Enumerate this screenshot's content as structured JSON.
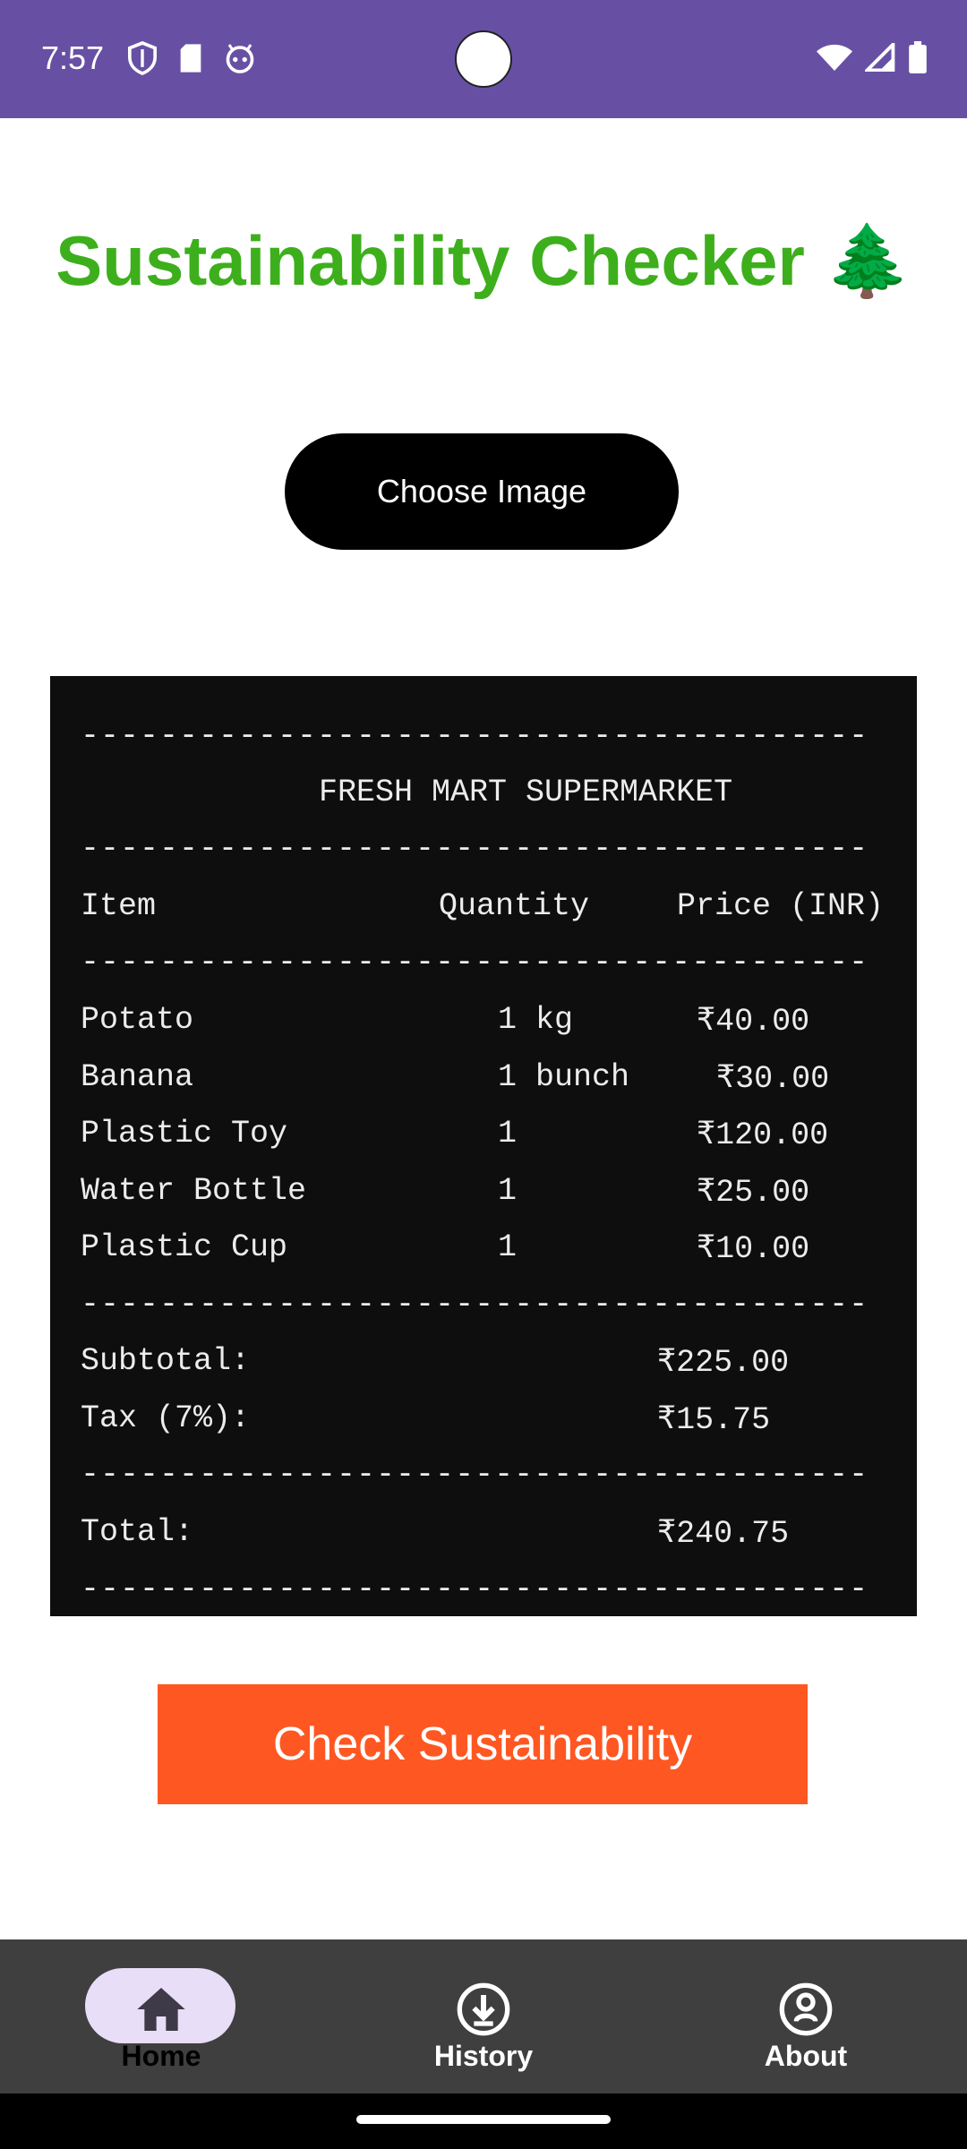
{
  "status_bar": {
    "time": "7:57",
    "left_icons": [
      "shield-icon",
      "sd-card-icon",
      "robot-icon"
    ],
    "right_icons": [
      "wifi-icon",
      "signal-icon",
      "battery-icon"
    ]
  },
  "title": "Sustainability Checker 🌲",
  "choose_image_label": "Choose Image",
  "receipt": {
    "dash_line": "----------------------------------------",
    "store_name": "FRESH MART SUPERMARKET",
    "header": {
      "item": "Item",
      "quantity": "Quantity",
      "price": "Price (INR)"
    },
    "rows": [
      {
        "item": "Potato",
        "quantity": "1 kg",
        "price": "₹40.00"
      },
      {
        "item": "Banana",
        "quantity": "1 bunch",
        "price": "₹30.00"
      },
      {
        "item": "Plastic Toy",
        "quantity": "1",
        "price": "₹120.00"
      },
      {
        "item": "Water Bottle",
        "quantity": "1",
        "price": "₹25.00"
      },
      {
        "item": "Plastic Cup",
        "quantity": "1",
        "price": "₹10.00"
      }
    ],
    "subtotal_label": "Subtotal:",
    "subtotal_value": "₹225.00",
    "tax_label": "Tax (7%):",
    "tax_value": "₹15.75",
    "total_label": "Total:",
    "total_value": "₹240.75"
  },
  "check_button_label": "Check Sustainability",
  "nav": {
    "items": [
      {
        "label": "Home",
        "icon": "home-icon",
        "selected": true
      },
      {
        "label": "History",
        "icon": "download-circle-icon",
        "selected": false
      },
      {
        "label": "About",
        "icon": "info-circle-icon",
        "selected": false
      }
    ]
  },
  "colors": {
    "status_bar": "#6750A4",
    "title": "#3DAF1C",
    "check_button": "#FF5722",
    "nav_bg": "#3F3F3F",
    "nav_pill": "#E8DEF8"
  }
}
